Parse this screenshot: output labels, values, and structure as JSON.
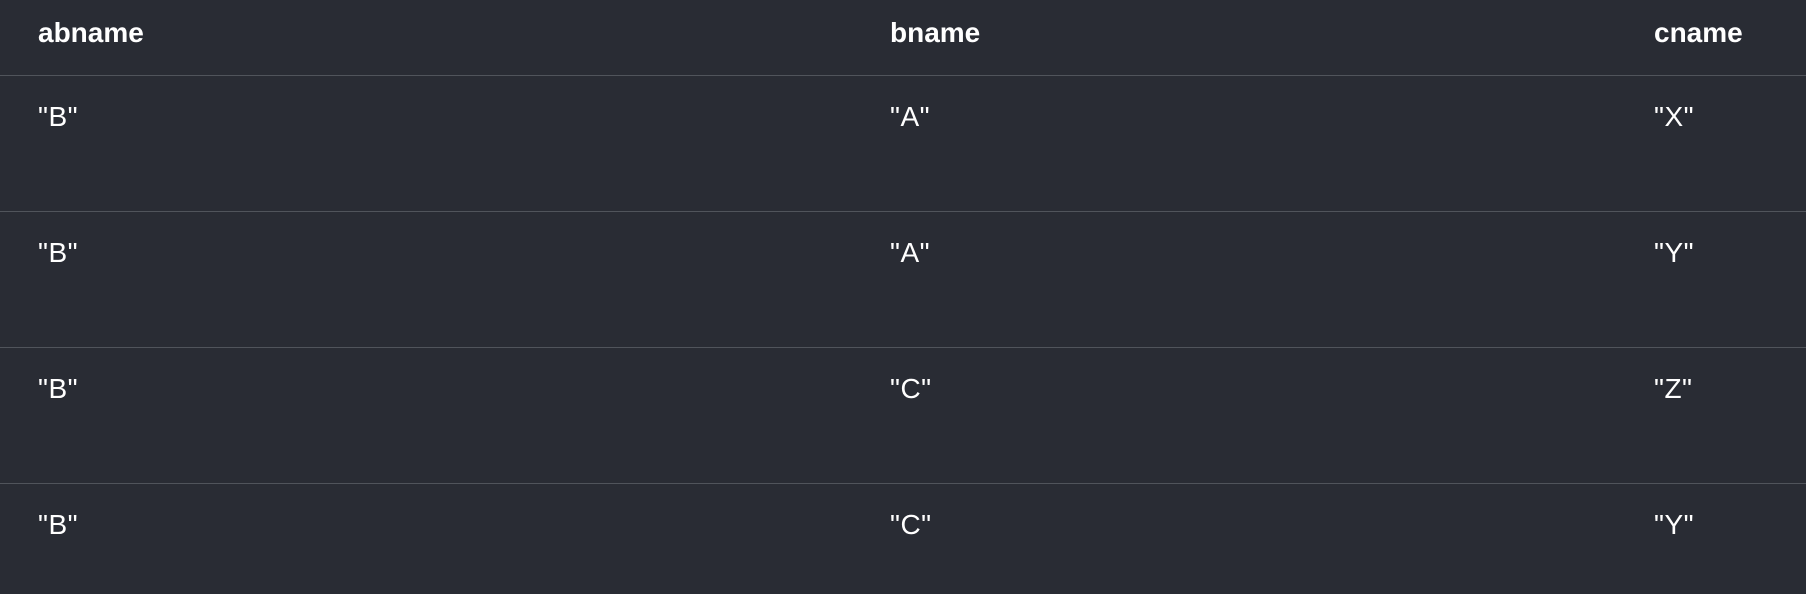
{
  "table": {
    "columns": [
      "abname",
      "bname",
      "cname"
    ],
    "rows": [
      [
        "\"B\"",
        "\"A\"",
        "\"X\""
      ],
      [
        "\"B\"",
        "\"A\"",
        "\"Y\""
      ],
      [
        "\"B\"",
        "\"C\"",
        "\"Z\""
      ],
      [
        "\"B\"",
        "\"C\"",
        "\"Y\""
      ]
    ]
  },
  "colors": {
    "background": "#292c34",
    "divider": "#50545b",
    "text": "#ffffff"
  }
}
